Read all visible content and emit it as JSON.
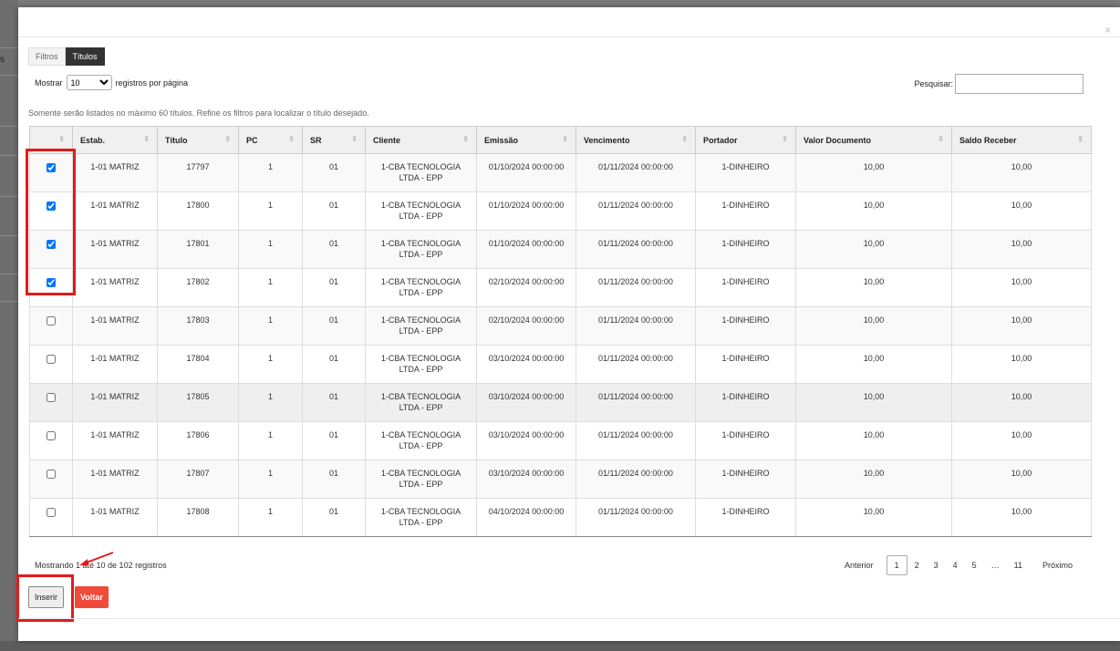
{
  "backdrop": {
    "left_letter": "s"
  },
  "modal": {
    "close_glyph": "×"
  },
  "tabs": [
    {
      "label": "Filtros",
      "active": false
    },
    {
      "label": "Títulos",
      "active": true
    }
  ],
  "length_menu": {
    "prefix": "Mostrar",
    "selected": "10",
    "suffix": "registros por página"
  },
  "search": {
    "label": "Pesquisar:",
    "value": ""
  },
  "info_note": "Somente serão listados no máximo 60 títulos. Refine os filtros para localizar o título desejado.",
  "table": {
    "columns": [
      "",
      "Estab.",
      "Título",
      "PC",
      "SR",
      "Cliente",
      "Emissão",
      "Vencimento",
      "Portador",
      "Valor Documento",
      "Saldo Receber"
    ],
    "sort_glyph": "⇕",
    "rows": [
      {
        "checked": true,
        "estab": "1-01 MATRIZ",
        "titulo": "17797",
        "pc": "1",
        "sr": "01",
        "cliente_l1": "1-CBA TECNOLOGIA",
        "cliente_l2": "LTDA - EPP",
        "emissao": "01/10/2024 00:00:00",
        "vencimento": "01/11/2024 00:00:00",
        "portador": "1-DINHEIRO",
        "valor": "10,00",
        "saldo": "10,00"
      },
      {
        "checked": true,
        "estab": "1-01 MATRIZ",
        "titulo": "17800",
        "pc": "1",
        "sr": "01",
        "cliente_l1": "1-CBA TECNOLOGIA",
        "cliente_l2": "LTDA - EPP",
        "emissao": "01/10/2024 00:00:00",
        "vencimento": "01/11/2024 00:00:00",
        "portador": "1-DINHEIRO",
        "valor": "10,00",
        "saldo": "10,00"
      },
      {
        "checked": true,
        "estab": "1-01 MATRIZ",
        "titulo": "17801",
        "pc": "1",
        "sr": "01",
        "cliente_l1": "1-CBA TECNOLOGIA",
        "cliente_l2": "LTDA - EPP",
        "emissao": "01/10/2024 00:00:00",
        "vencimento": "01/11/2024 00:00:00",
        "portador": "1-DINHEIRO",
        "valor": "10,00",
        "saldo": "10,00"
      },
      {
        "checked": true,
        "estab": "1-01 MATRIZ",
        "titulo": "17802",
        "pc": "1",
        "sr": "01",
        "cliente_l1": "1-CBA TECNOLOGIA",
        "cliente_l2": "LTDA - EPP",
        "emissao": "02/10/2024 00:00:00",
        "vencimento": "01/11/2024 00:00:00",
        "portador": "1-DINHEIRO",
        "valor": "10,00",
        "saldo": "10,00"
      },
      {
        "checked": false,
        "estab": "1-01 MATRIZ",
        "titulo": "17803",
        "pc": "1",
        "sr": "01",
        "cliente_l1": "1-CBA TECNOLOGIA",
        "cliente_l2": "LTDA - EPP",
        "emissao": "02/10/2024 00:00:00",
        "vencimento": "01/11/2024 00:00:00",
        "portador": "1-DINHEIRO",
        "valor": "10,00",
        "saldo": "10,00"
      },
      {
        "checked": false,
        "estab": "1-01 MATRIZ",
        "titulo": "17804",
        "pc": "1",
        "sr": "01",
        "cliente_l1": "1-CBA TECNOLOGIA",
        "cliente_l2": "LTDA - EPP",
        "emissao": "03/10/2024 00:00:00",
        "vencimento": "01/11/2024 00:00:00",
        "portador": "1-DINHEIRO",
        "valor": "10,00",
        "saldo": "10,00"
      },
      {
        "checked": false,
        "estab": "1-01 MATRIZ",
        "titulo": "17805",
        "pc": "1",
        "sr": "01",
        "cliente_l1": "1-CBA TECNOLOGIA",
        "cliente_l2": "LTDA - EPP",
        "emissao": "03/10/2024 00:00:00",
        "vencimento": "01/11/2024 00:00:00",
        "portador": "1-DINHEIRO",
        "valor": "10,00",
        "saldo": "10,00",
        "hovered": true
      },
      {
        "checked": false,
        "estab": "1-01 MATRIZ",
        "titulo": "17806",
        "pc": "1",
        "sr": "01",
        "cliente_l1": "1-CBA TECNOLOGIA",
        "cliente_l2": "LTDA - EPP",
        "emissao": "03/10/2024 00:00:00",
        "vencimento": "01/11/2024 00:00:00",
        "portador": "1-DINHEIRO",
        "valor": "10,00",
        "saldo": "10,00"
      },
      {
        "checked": false,
        "estab": "1-01 MATRIZ",
        "titulo": "17807",
        "pc": "1",
        "sr": "01",
        "cliente_l1": "1-CBA TECNOLOGIA",
        "cliente_l2": "LTDA - EPP",
        "emissao": "03/10/2024 00:00:00",
        "vencimento": "01/11/2024 00:00:00",
        "portador": "1-DINHEIRO",
        "valor": "10,00",
        "saldo": "10,00"
      },
      {
        "checked": false,
        "estab": "1-01 MATRIZ",
        "titulo": "17808",
        "pc": "1",
        "sr": "01",
        "cliente_l1": "1-CBA TECNOLOGIA",
        "cliente_l2": "LTDA - EPP",
        "emissao": "04/10/2024 00:00:00",
        "vencimento": "01/11/2024 00:00:00",
        "portador": "1-DINHEIRO",
        "valor": "10,00",
        "saldo": "10,00"
      }
    ]
  },
  "summary": "Mostrando 1 até 10 de 102 registros",
  "pagination": {
    "prev": "Anterior",
    "pages": [
      "1",
      "2",
      "3",
      "4",
      "5"
    ],
    "ellipsis": "…",
    "last": "11",
    "next": "Próximo",
    "current": "1"
  },
  "buttons": {
    "insert": "Inserir",
    "back": "Voltar"
  },
  "colors": {
    "highlight": "#e41a1a",
    "voltar": "#f04a3a",
    "tab_active": "#333333"
  }
}
